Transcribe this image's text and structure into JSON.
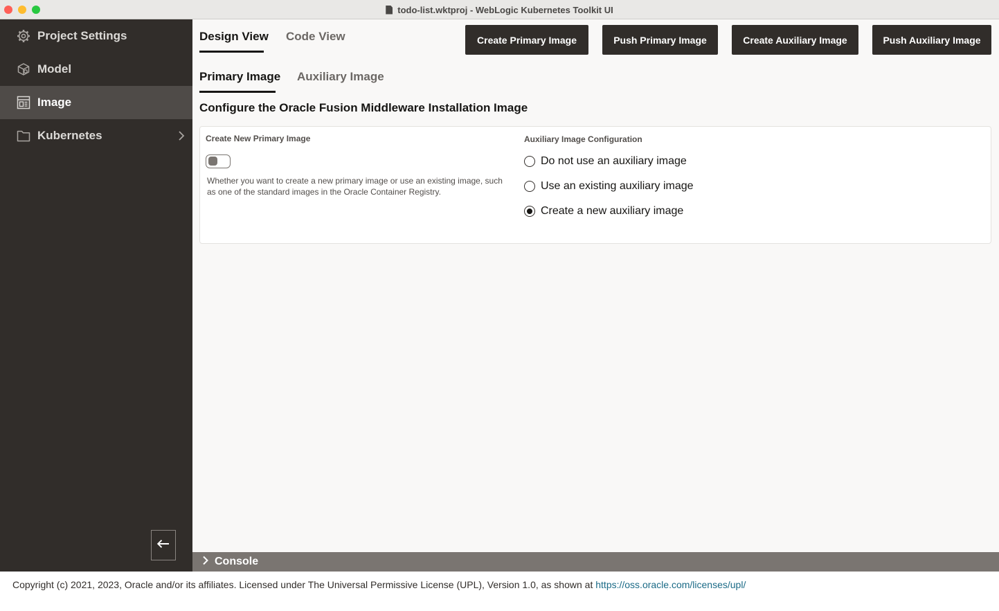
{
  "window": {
    "title": "todo-list.wktproj - WebLogic Kubernetes Toolkit UI",
    "doc_icon": "document-icon"
  },
  "sidebar": {
    "items": [
      {
        "label": "Project Settings",
        "icon": "gear-icon"
      },
      {
        "label": "Model",
        "icon": "cube-icon"
      },
      {
        "label": "Image",
        "icon": "image-layout-icon",
        "active": true
      },
      {
        "label": "Kubernetes",
        "icon": "folder-icon"
      }
    ],
    "collapse_icon": "arrow-left-icon"
  },
  "tabs": {
    "view": [
      {
        "label": "Design View",
        "active": true
      },
      {
        "label": "Code View",
        "active": false
      }
    ],
    "image": [
      {
        "label": "Primary Image",
        "active": true
      },
      {
        "label": "Auxiliary Image",
        "active": false
      }
    ]
  },
  "actions": {
    "create_primary": "Create Primary Image",
    "push_primary": "Push Primary Image",
    "create_auxiliary": "Create Auxiliary Image",
    "push_auxiliary": "Push Auxiliary Image"
  },
  "section": {
    "title": "Configure the Oracle Fusion Middleware Installation Image"
  },
  "primary": {
    "label": "Create New Primary Image",
    "toggle_on": false,
    "help": "Whether you want to create a new primary image or use an existing image, such as one of the standard images in the Oracle Container Registry."
  },
  "auxiliary": {
    "label": "Auxiliary Image Configuration",
    "options": [
      {
        "label": "Do not use an auxiliary image",
        "checked": false
      },
      {
        "label": "Use an existing auxiliary image",
        "checked": false
      },
      {
        "label": "Create a new auxiliary image",
        "checked": true
      }
    ]
  },
  "console": {
    "label": "Console",
    "icon": "chevron-right-icon"
  },
  "footer": {
    "text": "Copyright (c) 2021, 2023, Oracle and/or its affiliates. Licensed under The Universal Permissive License (UPL), Version 1.0, as shown at ",
    "link": "https://oss.oracle.com/licenses/upl/"
  },
  "colors": {
    "sidebar_bg": "#312d2a",
    "sidebar_active": "#4f4b48",
    "button_bg": "#312d2a",
    "console_bg": "#7a7571",
    "link": "#1a6a86"
  }
}
